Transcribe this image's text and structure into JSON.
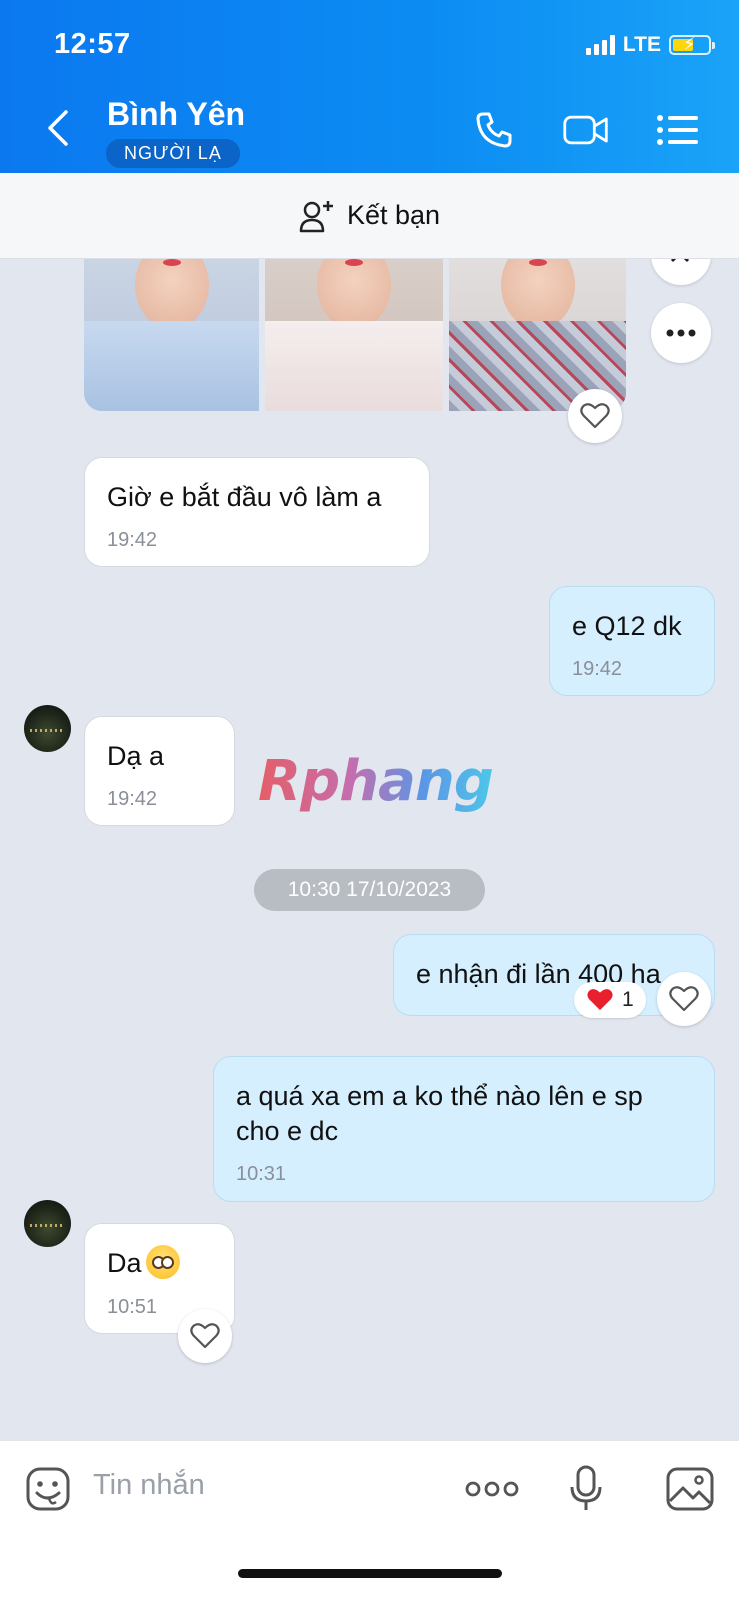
{
  "status_bar": {
    "time": "12:57",
    "network": "LTE"
  },
  "header": {
    "contact_name": "Bình Yên",
    "badge": "NGƯỜI LẠ",
    "icons": [
      "back-icon",
      "phone-icon",
      "video-icon",
      "menu-icon"
    ],
    "accent": "#0c8df3"
  },
  "add_friend": {
    "label": "Kết bạn",
    "icon": "add-user-icon"
  },
  "chat": {
    "date_separator": "10:30 17/10/2023",
    "messages": [
      {
        "side": "in",
        "text": "Giờ e bắt đầu vô làm a",
        "time": "19:42"
      },
      {
        "side": "out",
        "text": "e Q12 dk",
        "time": "19:42"
      },
      {
        "side": "in",
        "text": "Dạ a",
        "time": "19:42"
      },
      {
        "side": "out",
        "text": "e nhận đi lần 400 ha",
        "time": "",
        "reaction_count": "1"
      },
      {
        "side": "out",
        "text": "a quá xa em a ko thể nào lên e sp cho e dc",
        "time": "10:31"
      },
      {
        "side": "in",
        "text": "Da",
        "time": "10:51"
      }
    ],
    "watermark": "Rphang"
  },
  "input_bar": {
    "placeholder": "Tin nhắn"
  },
  "colors": {
    "incoming_bubble": "#ffffff",
    "outgoing_bubble": "#d5efff",
    "chat_bg": "#e2e6ef"
  }
}
